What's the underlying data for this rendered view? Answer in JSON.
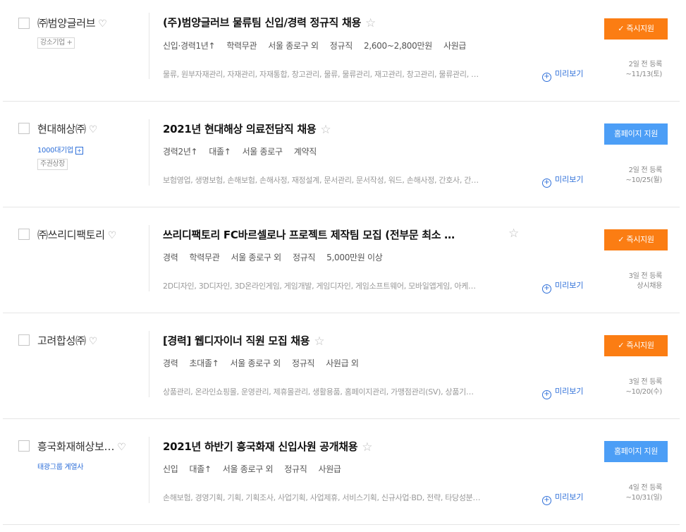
{
  "preview_label": "미리보기",
  "jobs": [
    {
      "company": "㈜범양글러브",
      "company_tag": "강소기업 +",
      "title": "(주)범양글러브 물류팀 신입/경력 정규직 채용",
      "conditions": [
        "신입·경력1년↑",
        "학력무관",
        "서울 종로구 외",
        "정규직",
        "2,600~2,800만원",
        "사원급"
      ],
      "sector": "물류, 원부자재관리, 자재관리, 자재통합, 창고관리, 물류, 물류관리, 재고관리, 창고관리, 물류관리, …",
      "apply_label": "✓ 즉시지원",
      "posted": "2일 전 등록",
      "deadline": "~11/13(토)"
    },
    {
      "company": "현대해상㈜",
      "company_tag": "1000대기업",
      "company_tag2": "주권상장",
      "title": "2021년 현대해상 의료전담직 채용",
      "conditions": [
        "경력2년↑",
        "대졸↑",
        "서울 종로구",
        "계약직"
      ],
      "sector": "보험영업, 생명보험, 손해보험, 손해사정, 재정설계, 문서관리, 문서작성, 워드, 손해사정, 간호사, 간…",
      "apply_label": "홈페이지 지원",
      "posted": "2일 전 등록",
      "deadline": "~10/25(월)"
    },
    {
      "company": "㈜쓰리디팩토리",
      "title": "쓰리디팩토리 FC바르셀로나 프로젝트 제작팀 모집 (전부문 최소 …",
      "conditions": [
        "경력",
        "학력무관",
        "서울 종로구 외",
        "정규직",
        "5,000만원 이상"
      ],
      "sector": "2D디자인, 3D디자인, 3D온라인게임, 게임개발, 게임디자인, 게임소프트웨어, 모바일앱게임, 아케…",
      "apply_label": "✓ 즉시지원",
      "posted": "3일 전 등록",
      "deadline": "상시채용"
    },
    {
      "company": "고려합성㈜",
      "title": "[경력] 웹디자이너 직원 모집 채용",
      "conditions": [
        "경력",
        "초대졸↑",
        "서울 종로구 외",
        "정규직",
        "사원급 외"
      ],
      "sector": "상품관리, 온라인쇼핑몰, 운영관리, 제휴몰관리, 생활용품, 홈페이지관리, 가맹점관리(SV), 상품기…",
      "apply_label": "✓ 즉시지원",
      "posted": "3일 전 등록",
      "deadline": "~10/20(수)"
    },
    {
      "company": "흥국화재해상보…",
      "company_tag": "태광그룹 계열사",
      "title": "2021년 하반기 흥국화재 신입사원 공개채용",
      "conditions": [
        "신입",
        "대졸↑",
        "서울 종로구 외",
        "정규직",
        "사원급"
      ],
      "sector": "손해보험, 경영기획, 기획, 기획조사, 사업기획, 사업제휴, 서비스기획, 신규사업·BD, 전략, 타당성분…",
      "apply_label": "홈페이지 지원",
      "posted": "4일 전 등록",
      "deadline": "~10/31(일)"
    }
  ]
}
